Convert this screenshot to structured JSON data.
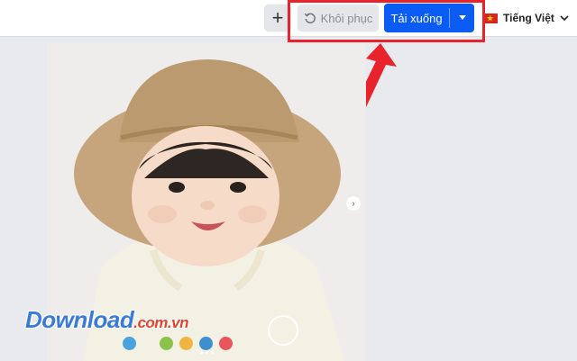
{
  "toolbar": {
    "add_label": "+",
    "restore_label": "Khôi phục",
    "download_label": "Tải xuống",
    "language_label": "Tiếng Việt"
  },
  "colors": {
    "primary": "#0a5cf5",
    "highlight": "#e8232b",
    "background": "#e9eaee"
  },
  "icons": {
    "restore": "restore-icon",
    "caret": "caret-down-icon",
    "flag": "vietnam-flag-icon",
    "chevron": "chevron-down-icon",
    "next": "chevron-right-icon"
  },
  "watermark": {
    "brand": "Download",
    "domain": ".com.vn"
  },
  "swatches": [
    "#4aa3df",
    "#8bc34a",
    "#f0b540",
    "#3f8fd0",
    "#e9545a"
  ]
}
